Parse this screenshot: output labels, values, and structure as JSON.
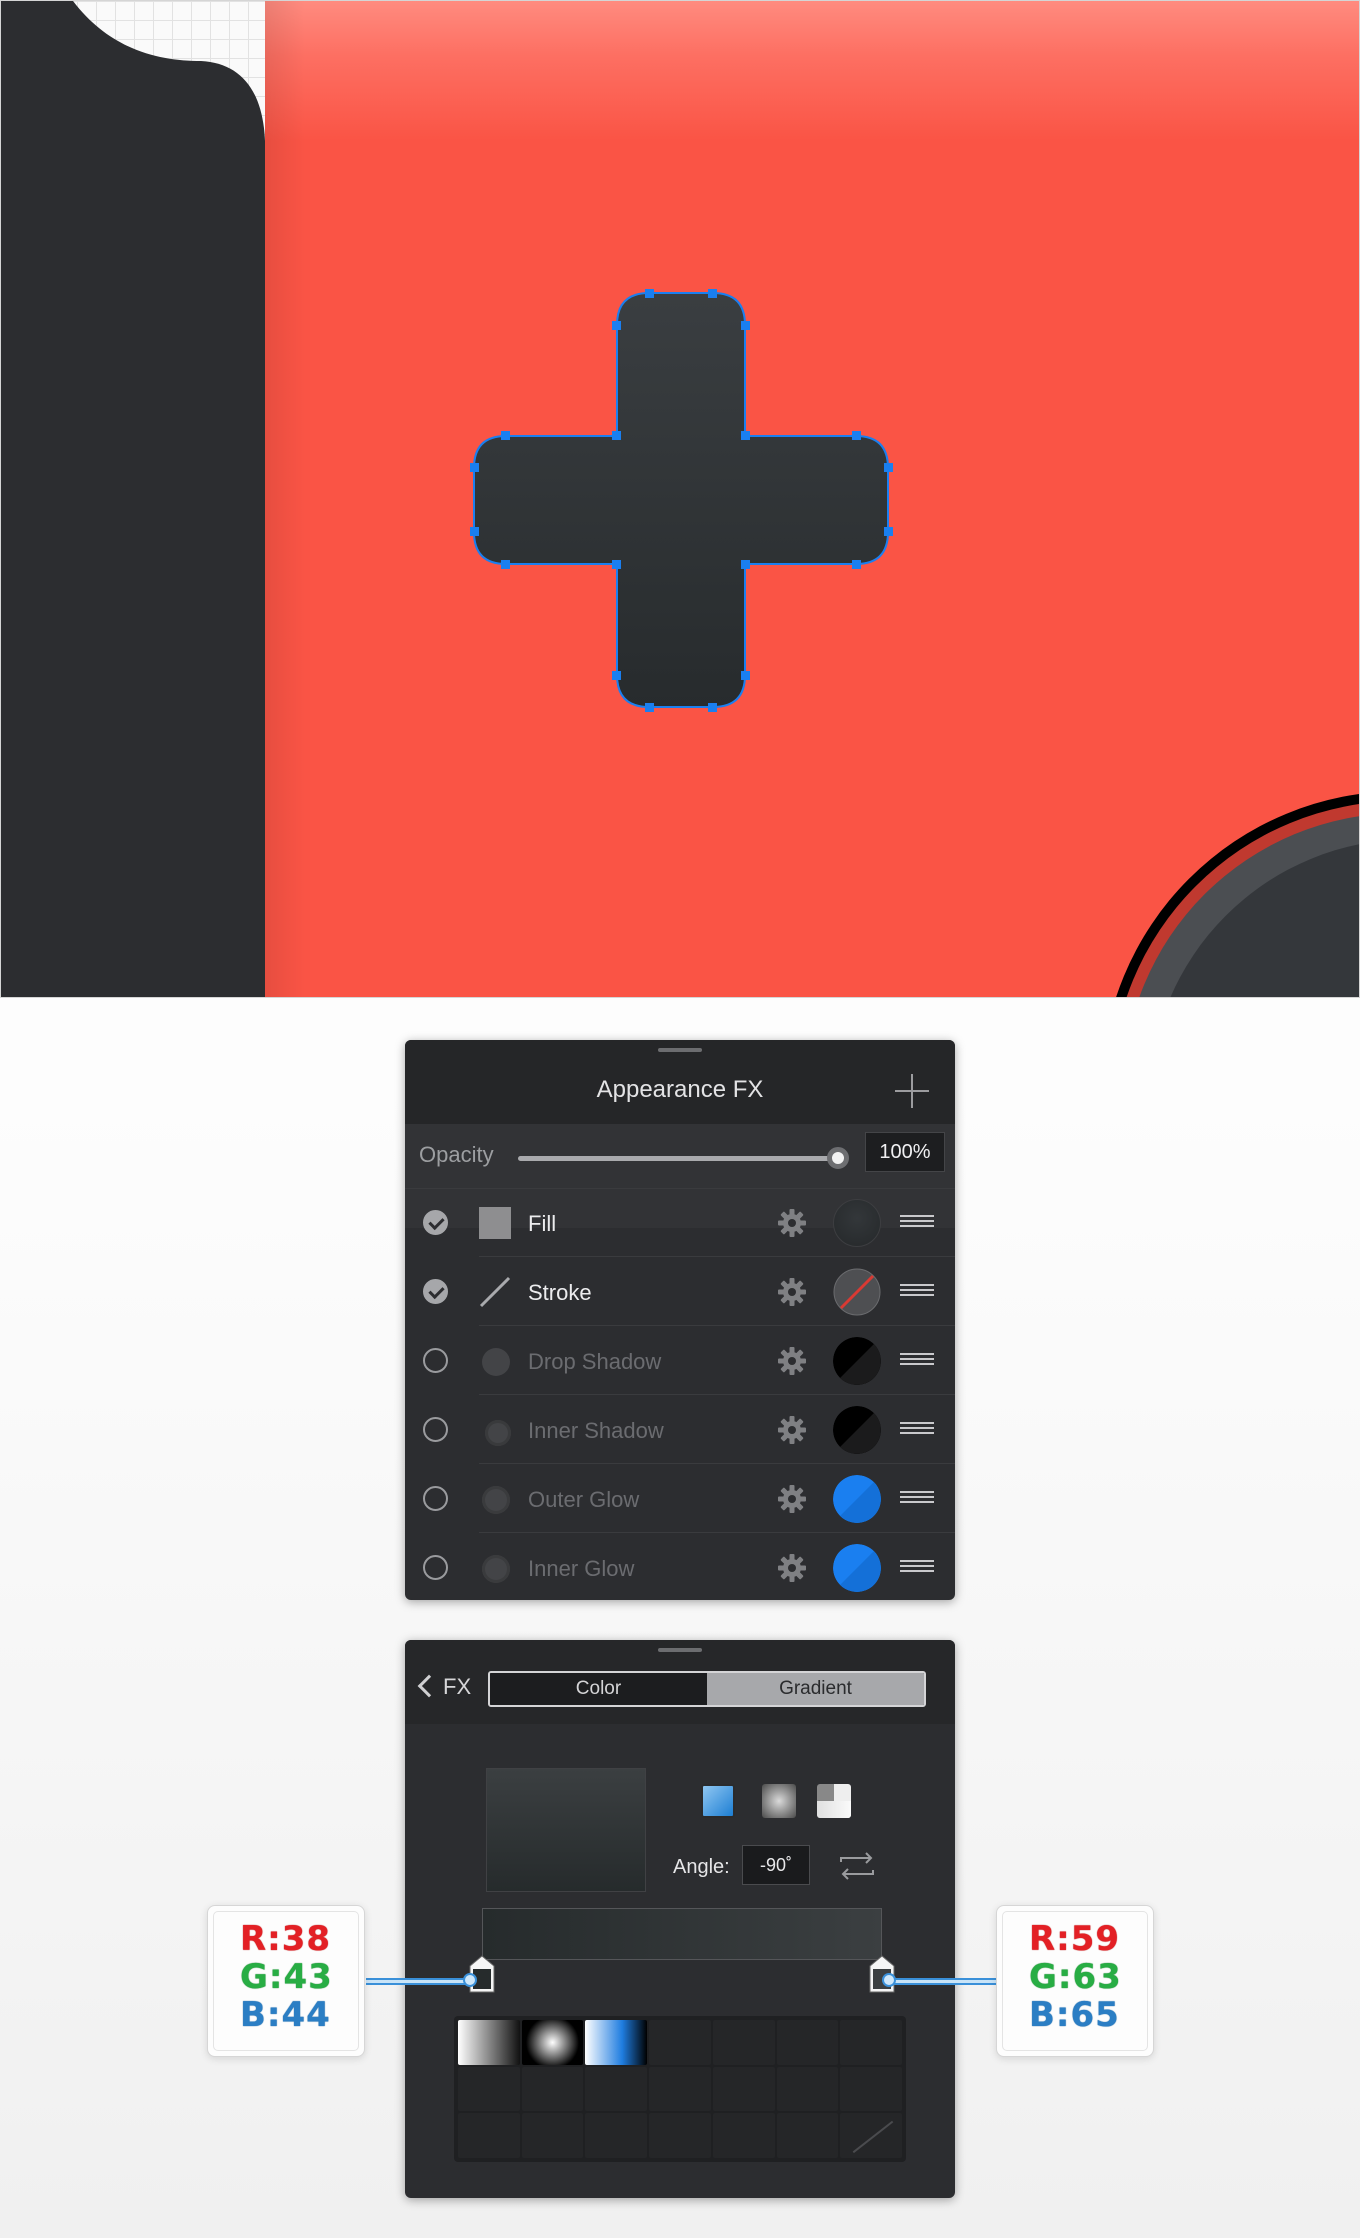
{
  "appearance_panel": {
    "title": "Appearance FX",
    "opacity_label": "Opacity",
    "opacity_value": "100%",
    "opacity_fraction": 1.0,
    "effects": [
      {
        "label": "Fill",
        "enabled": true,
        "icon": "fill-square-icon",
        "swatch": "#2f3336"
      },
      {
        "label": "Stroke",
        "enabled": true,
        "icon": "stroke-line-icon",
        "swatch": "none"
      },
      {
        "label": "Drop Shadow",
        "enabled": false,
        "icon": "drop-shadow-icon",
        "swatch": "#000000"
      },
      {
        "label": "Inner Shadow",
        "enabled": false,
        "icon": "inner-shadow-icon",
        "swatch": "#000000"
      },
      {
        "label": "Outer Glow",
        "enabled": false,
        "icon": "outer-glow-icon",
        "swatch": "#1a7ff0"
      },
      {
        "label": "Inner Glow",
        "enabled": false,
        "icon": "inner-glow-icon",
        "swatch": "#1a7ff0"
      }
    ]
  },
  "gradient_panel": {
    "back_label": "FX",
    "tabs": {
      "color": "Color",
      "gradient": "Gradient"
    },
    "active_tab": "gradient",
    "angle_label": "Angle:",
    "angle_value": "-90˚",
    "gradient_types": [
      "linear-gradient-icon",
      "radial-gradient-icon",
      "conical-gradient-icon"
    ],
    "stops": [
      {
        "color": "#262b2c",
        "position": 0
      },
      {
        "color": "#3b3f41",
        "position": 1
      }
    ]
  },
  "callouts": {
    "left": {
      "r": "R:38",
      "g": "G:43",
      "b": "B:44"
    },
    "right": {
      "r": "R:59",
      "g": "G:63",
      "b": "B:65"
    }
  },
  "colors": {
    "background_red": "#fa5445",
    "cross_fill": "#2f3336",
    "selection_blue": "#1a7ff0",
    "panel_dark": "#2c2d30"
  }
}
